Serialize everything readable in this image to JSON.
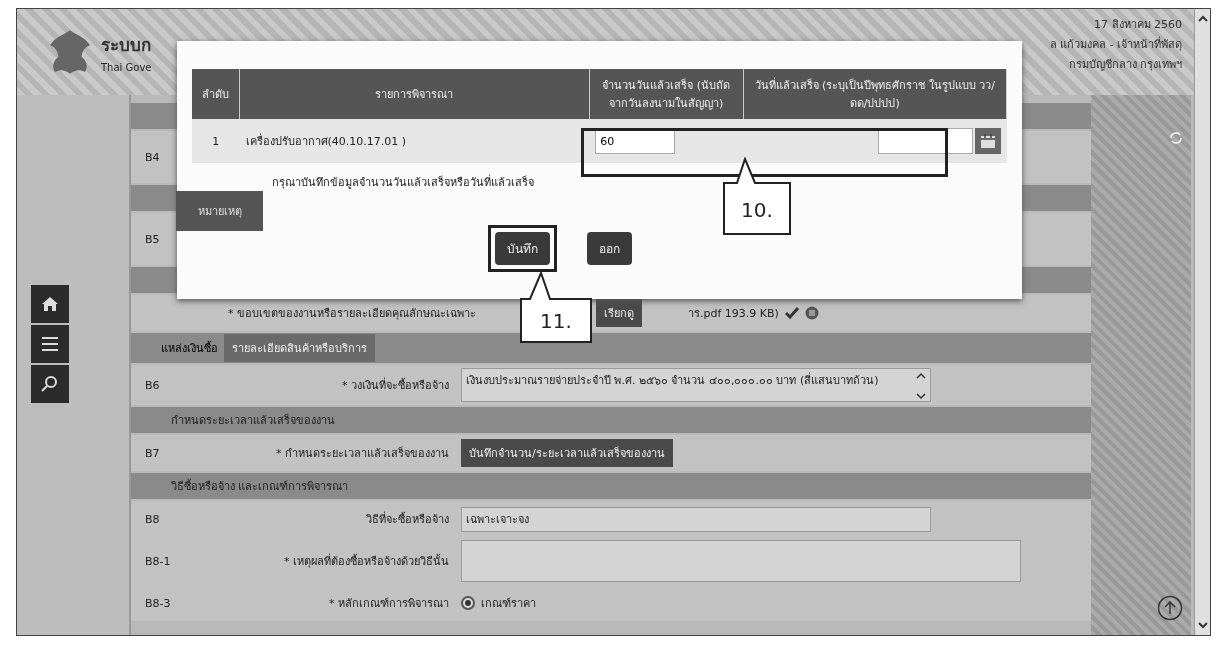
{
  "header": {
    "title": "ระบบก",
    "subtitle": "Thai Gove",
    "date": "17 สิงหาคม 2560",
    "user": "ล แก้วมงคล - เจ้าหน้าที่พัสดุ",
    "department": "กรมบัญชีกลาง กรุงเทพฯ"
  },
  "sidebar": {
    "buttons": [
      {
        "kind": "home"
      },
      {
        "kind": "menu"
      },
      {
        "kind": "search"
      }
    ]
  },
  "form": {
    "rows": [
      {
        "kind": "section"
      },
      {
        "kind": "field",
        "code": "B4"
      },
      {
        "kind": "section"
      },
      {
        "kind": "field",
        "code": "B5"
      },
      {
        "kind": "section"
      },
      {
        "kind": "file",
        "label": "* ขอบเขตของงานหรือรายละเอียดคุณลักษณะเฉพาะ",
        "button": "เรียกดู",
        "file": "าร.pdf 193.9 KB)"
      },
      {
        "kind": "subsection",
        "title": "แหล่งเงินซื้อ",
        "button": "รายละเอียดสินค้าหรือบริการ"
      },
      {
        "kind": "textarea",
        "code": "B6",
        "label": "* วงเงินที่จะซื้อหรือจ้าง",
        "value": "เงินงบประมาณรายจ่ายประจำปี พ.ศ. ๒๕๖๐ จำนวน ๔๐๐,๐๐๐.๐๐ บาท (สี่แสนบาทถ้วน)"
      },
      {
        "kind": "section",
        "title": "กำหนดระยะเวลาแล้วเสร็จของงาน"
      },
      {
        "kind": "button",
        "code": "B7",
        "label": "* กำหนดระยะเวลาแล้วเสร็จของงาน",
        "button": "บันทึกจำนวน/ระยะเวลาแล้วเสร็จของงาน"
      },
      {
        "kind": "section",
        "title": "วิธีซื้อหรือจ้าง และเกณฑ์การพิจารณา"
      },
      {
        "kind": "text",
        "code": "B8",
        "label": "วิธีที่จะซื้อหรือจ้าง",
        "value": "เฉพาะเจาะจง"
      },
      {
        "kind": "textarea",
        "code": "B8-1",
        "label": "* เหตุผลที่ต้องซื้อหรือจ้างด้วยวิธีนั้น"
      },
      {
        "kind": "radio",
        "code": "B8-3",
        "label": "* หลักเกณฑ์การพิจารณา",
        "options": [
          {
            "label": "เกณฑ์ราคา",
            "selected": true
          }
        ]
      }
    ]
  },
  "note_button": "หมายเหตุ",
  "modal": {
    "columns": [
      "ลำดับ",
      "รายการพิจารณา",
      "จำนวนวันแล้วเสร็จ (นับถัดจากวันลงนามในสัญญา)",
      "วันที่แล้วเสร็จ (ระบุเป็นปีพุทธศักราช ในรูปแบบ วว/ดด/ปปปป)"
    ],
    "rows": [
      {
        "index": "1",
        "item": "เครื่องปรับอากาศ(40.10.17.01 )",
        "days": "60"
      }
    ],
    "message": "กรุณาบันทึกข้อมูลจำนวนวันแล้วเสร็จหรือวันที่แล้วเสร็จ",
    "buttons": [
      "บันทึก",
      "ออก"
    ]
  },
  "callouts": [
    "10.",
    "11."
  ]
}
